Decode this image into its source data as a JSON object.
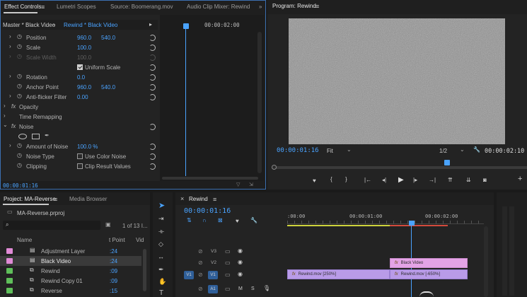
{
  "effect_controls": {
    "tabs": [
      "Effect Controls",
      "Lumetri Scopes",
      "Source: Boomerang.mov",
      "Audio Clip Mixer: Rewind"
    ],
    "more": "»",
    "master_label": "Master * Black Video",
    "sequence_label": "Rewind * Black Video",
    "ruler_time": "00:00:02:00",
    "position": {
      "label": "Position",
      "x": "960.0",
      "y": "540.0"
    },
    "scale": {
      "label": "Scale",
      "value": "100.0"
    },
    "scale_width": {
      "label": "Scale Width",
      "value": "100.0"
    },
    "uniform_scale": {
      "label": "Uniform Scale",
      "checked": true
    },
    "rotation": {
      "label": "Rotation",
      "value": "0.0"
    },
    "anchor_point": {
      "label": "Anchor Point",
      "x": "960.0",
      "y": "540.0"
    },
    "anti_flicker": {
      "label": "Anti-flicker Filter",
      "value": "0.00"
    },
    "opacity": {
      "label": "Opacity"
    },
    "time_remapping": {
      "label": "Time Remapping"
    },
    "noise": {
      "label": "Noise"
    },
    "amount_of_noise": {
      "label": "Amount of Noise",
      "value": "100.0 %"
    },
    "noise_type": {
      "label": "Noise Type",
      "option": "Use Color Noise"
    },
    "clipping": {
      "label": "Clipping",
      "option": "Clip Result Values"
    },
    "fx": "fx",
    "footer_time": "00:00:01:16"
  },
  "program": {
    "title": "Program: Rewind",
    "timecode": "00:00:01:16",
    "fit": "Fit",
    "resolution": "1/2",
    "duration": "00:00:02:10"
  },
  "project": {
    "tabs": [
      "Project: MA-Reverse",
      "Media Browser"
    ],
    "file": "MA-Reverse.prproj",
    "count": "1 of 13 I...",
    "columns": [
      "Name",
      "t Point",
      "Vid"
    ],
    "items": [
      {
        "name": "Adjustment Layer",
        "fps": ":24",
        "color": "#e08ad6"
      },
      {
        "name": "Black Video",
        "fps": ":24",
        "color": "#e08ad6"
      },
      {
        "name": "Rewind",
        "fps": ":09",
        "color": "#5fbf5a"
      },
      {
        "name": "Rewind Copy 01",
        "fps": ":09",
        "color": "#5fbf5a"
      },
      {
        "name": "Reverse",
        "fps": ":15",
        "color": "#5fbf5a"
      }
    ]
  },
  "timeline": {
    "tab": "Rewind",
    "timecode": "00:00:01:16",
    "ruler": [
      ":00:00",
      "00:00:01:00",
      "00:00:02:00"
    ],
    "tracks": {
      "v3": "V3",
      "v2": "V2",
      "v1_src": "V1",
      "v1": "V1",
      "a1_src": "A1",
      "m": "M",
      "s": "S"
    },
    "clips": {
      "black_video": "Black Video",
      "rewind_250": "Rewind.mov [250%]",
      "rewind_neg650": "Rewind.mov [-650%]"
    },
    "fx": "fx"
  },
  "colors": {
    "accent_blue": "#4aa3ff",
    "clip_purple": "#b99be8",
    "clip_pink": "#e4a3e6",
    "label_magenta": "#e08ad6",
    "label_green": "#5fbf5a"
  }
}
